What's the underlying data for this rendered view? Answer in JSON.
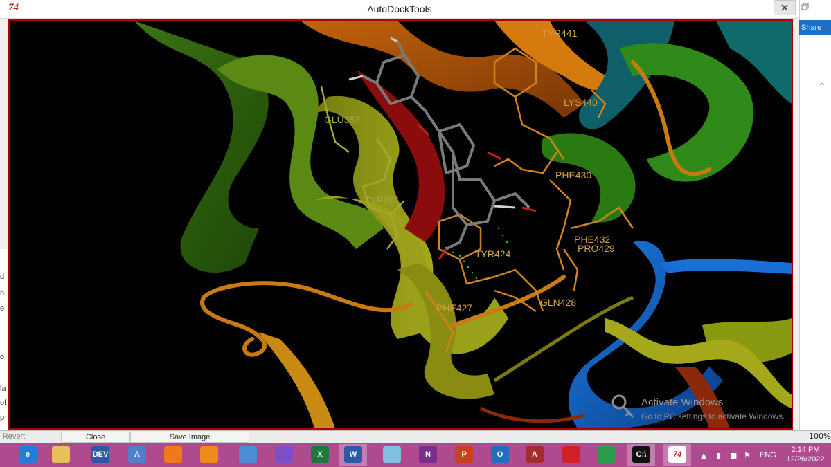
{
  "window": {
    "title": "AutoDockTools",
    "app_icon_glyph": "74",
    "close_icon": "close-icon"
  },
  "viewer": {
    "background": "#000000",
    "border_color": "#b00000",
    "residue_labels": [
      {
        "text": "TYR441",
        "color": "#d4a24a"
      },
      {
        "text": "LYS440",
        "color": "#d4a24a"
      },
      {
        "text": "GLU357",
        "color": "#a8a844"
      },
      {
        "text": "PHE430",
        "color": "#d4a24a"
      },
      {
        "text": "TYR361",
        "color": "#a8a844"
      },
      {
        "text": "PHE432",
        "color": "#d4a24a"
      },
      {
        "text": "PRO429",
        "color": "#d4a24a"
      },
      {
        "text": "TYR424",
        "color": "#d4a24a"
      },
      {
        "text": "GLN428",
        "color": "#d4a24a"
      },
      {
        "text": "PHE427",
        "color": "#d4a24a"
      }
    ]
  },
  "watermark": {
    "title": "Activate Windows",
    "subtitle": "Go to PC settings to activate Windows."
  },
  "side_panel": {
    "share_label": "Share"
  },
  "left_strip": [
    "d",
    "n",
    "e",
    "o",
    "la",
    "of",
    "p"
  ],
  "bottom_strip": {
    "revert_label": "Revert",
    "close_label": "Close",
    "save_image_label": "Save Image",
    "zoom": "100%"
  },
  "taskbar": {
    "apps": [
      {
        "name": "internet-explorer",
        "glyph": "e",
        "color": "#1e7fd8"
      },
      {
        "name": "file-explorer",
        "glyph": "",
        "color": "#e7c05a"
      },
      {
        "name": "dev-cpp",
        "glyph": "DEV",
        "color": "#2c58a8"
      },
      {
        "name": "document-viewer",
        "glyph": "A",
        "color": "#4f7fc9"
      },
      {
        "name": "firefox",
        "glyph": "",
        "color": "#f07a1a"
      },
      {
        "name": "vlc",
        "glyph": "",
        "color": "#f08a1a"
      },
      {
        "name": "send-app",
        "glyph": "",
        "color": "#4a8fd6"
      },
      {
        "name": "visual-studio",
        "glyph": "",
        "color": "#7a4fc9"
      },
      {
        "name": "excel",
        "glyph": "X",
        "color": "#1e7a3c"
      },
      {
        "name": "word",
        "glyph": "W",
        "color": "#2b5ba8",
        "active": true
      },
      {
        "name": "notes-app",
        "glyph": "",
        "color": "#7fbfe0"
      },
      {
        "name": "onenote",
        "glyph": "N",
        "color": "#7a2f8f"
      },
      {
        "name": "powerpoint",
        "glyph": "P",
        "color": "#c8421e"
      },
      {
        "name": "outlook",
        "glyph": "O",
        "color": "#1f6fc0"
      },
      {
        "name": "access",
        "glyph": "A",
        "color": "#a32b2b"
      },
      {
        "name": "pdf-app",
        "glyph": "",
        "color": "#d42020"
      },
      {
        "name": "chrome",
        "glyph": "",
        "color": "#2e9b4a"
      },
      {
        "name": "command-prompt",
        "glyph": "C:\\",
        "color": "#111111",
        "active": true
      },
      {
        "name": "tk-app",
        "glyph": "74",
        "color": "#ffffff",
        "active": true
      }
    ],
    "language": "ENG",
    "time": "2:14 PM",
    "date": "12/26/2022"
  }
}
